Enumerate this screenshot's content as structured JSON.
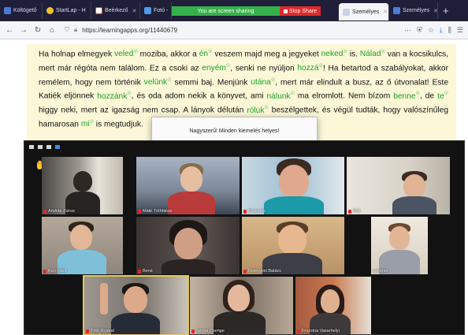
{
  "browser": {
    "tabs": [
      {
        "label": "Költögető",
        "color": "#4b7bd6",
        "active": false
      },
      {
        "label": "StartLap - H",
        "color": "#f2c030",
        "active": false
      },
      {
        "label": "Beérkező",
        "color": "#d94436",
        "active": false
      },
      {
        "label": "Fotó -",
        "color": "#4e9be8",
        "active": false
      },
      {
        "label": "Személyes",
        "color": "#e8edf5",
        "active": true
      },
      {
        "label": "Személyes",
        "color": "#4a7ed8",
        "active": false
      }
    ],
    "new_tab": "+",
    "share_bar": {
      "message": "You are screen sharing",
      "stop_label": "Stop Share"
    },
    "url": "https://learningapps.org/11440679"
  },
  "exercise": {
    "segments": [
      {
        "t": "Ha holnap elmegyek "
      },
      {
        "a": "veled"
      },
      {
        "t": " moziba, akkor a "
      },
      {
        "a": "én"
      },
      {
        "t": " veszem majd meg a jegyeket "
      },
      {
        "a": "neked"
      },
      {
        "t": " is. "
      },
      {
        "a": "Nálad"
      },
      {
        "t": " van a kocsikulcs, mert már régóta nem találom. Ez a csoki az "
      },
      {
        "a": "enyém"
      },
      {
        "t": ", senki ne nyúljon "
      },
      {
        "a": "hozzá"
      },
      {
        "t": "! Ha betartod a szabályokat, akkor remélem, hogy nem történik "
      },
      {
        "a": "velünk"
      },
      {
        "t": " semmi baj. Menjünk "
      },
      {
        "a": "utána"
      },
      {
        "t": ", mert már elindult a busz, az ő útvonalat! Este Katiék eljönnek "
      },
      {
        "a": "hozzánk"
      },
      {
        "t": ", és oda adom nekik a könyvet, ami "
      },
      {
        "a": "nálunk"
      },
      {
        "t": " ma elromlott. Nem bízom "
      },
      {
        "a": "benne"
      },
      {
        "t": ", de "
      },
      {
        "a": "te"
      },
      {
        "t": " higgy neki, mert az igazság nem csap. A lányok délután "
      },
      {
        "a": "róluk"
      },
      {
        "t": " beszélgettek, és végül tudták, hogy valószínűleg hamarosan "
      },
      {
        "a": "mi"
      },
      {
        "t": " is megtudjuk."
      }
    ]
  },
  "dialog": {
    "message": "Nagyszerű! Minden kiemelés helyes!",
    "ok_label": "OK"
  },
  "meeting": {
    "participants": [
      {
        "name": "András Zsiros",
        "speaking": false
      },
      {
        "name": "Máté Tóthfalusi",
        "speaking": false
      },
      {
        "name": "Bruta Ine",
        "speaking": false
      },
      {
        "name": "Bali",
        "speaking": false
      },
      {
        "name": "Kun Márk",
        "speaking": false
      },
      {
        "name": "Bené",
        "speaking": false
      },
      {
        "name": "Belényesi Balázs",
        "speaking": false
      },
      {
        "name": "Levente",
        "speaking": false
      },
      {
        "name": "Tóth Roland",
        "speaking": true
      },
      {
        "name": "Szima Csenge",
        "speaking": false
      },
      {
        "name": "Fruzsina Vasarhelyi",
        "speaking": false
      }
    ]
  }
}
